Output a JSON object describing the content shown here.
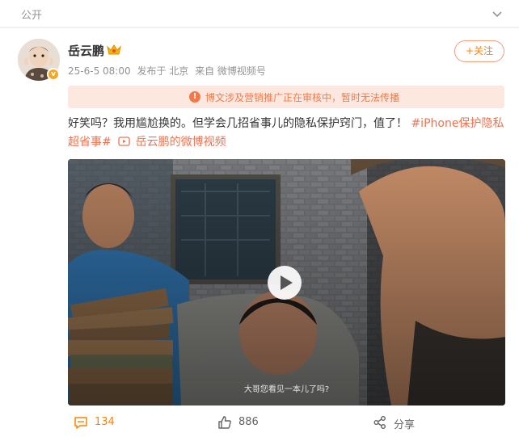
{
  "topbar": {
    "visibility": "公开"
  },
  "user": {
    "name": "岳云鹏",
    "timestamp": "25-6-5 08:00",
    "location": "发布于 北京",
    "source": "来自 微博视频号",
    "follow_label": "+关注"
  },
  "notice": {
    "text": "博文涉及营销推广正在审核中，暂时无法传播"
  },
  "post": {
    "text": "好笑吗？我用尴尬换的。但学会几招省事儿的隐私保护窍门，值了！",
    "tag": "#iPhone保护隐私超省事#",
    "video_link": "岳云鹏的微博视频"
  },
  "video": {
    "subtitle": "大哥您看见一本儿了吗?"
  },
  "actions": {
    "comments": "134",
    "likes": "886",
    "share_label": "分享"
  },
  "colors": {
    "accent": "#ff8200",
    "link": "#eb7350",
    "notice_bg": "#fde8e0",
    "muted": "#939393"
  }
}
